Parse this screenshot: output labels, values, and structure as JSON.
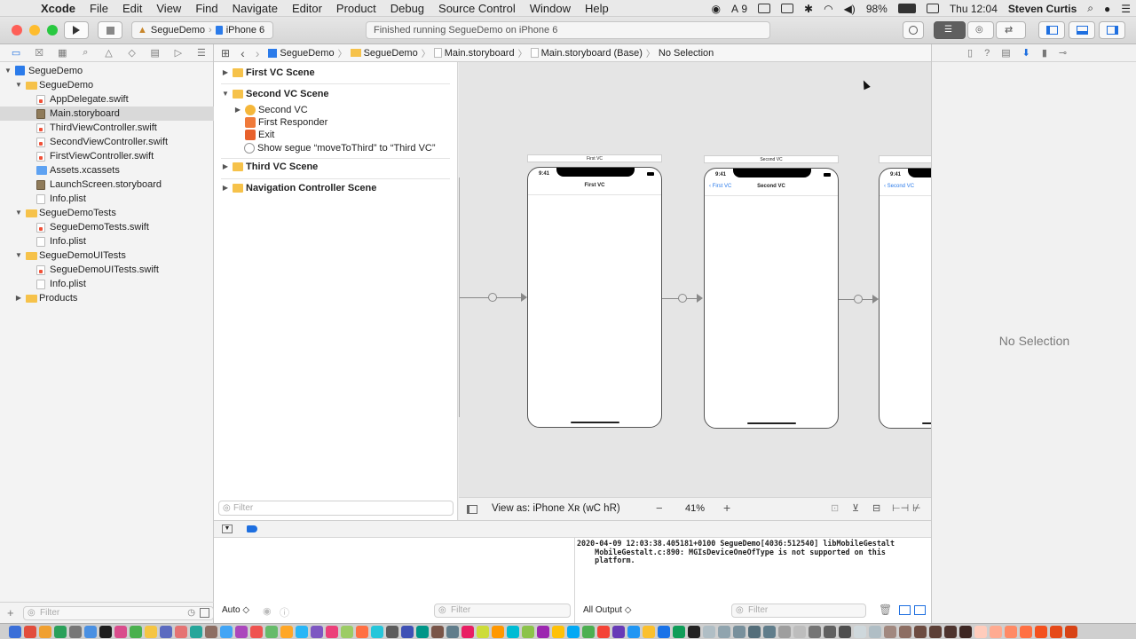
{
  "menubar": {
    "app": "Xcode",
    "menus": [
      "File",
      "Edit",
      "View",
      "Find",
      "Navigate",
      "Editor",
      "Product",
      "Debug",
      "Source Control",
      "Window",
      "Help"
    ],
    "adobe_count": "9",
    "battery": "98%",
    "clock": "Thu 12:04",
    "user": "Steven Curtis"
  },
  "toolbar": {
    "scheme": "SegueDemo",
    "device": "iPhone 6",
    "status": "Finished running SegueDemo on iPhone 6"
  },
  "navigator": {
    "tree": [
      {
        "label": "SegueDemo",
        "icon": "project-icon",
        "level": 0,
        "expanded": true
      },
      {
        "label": "SegueDemo",
        "icon": "folder-icon",
        "level": 1,
        "expanded": true
      },
      {
        "label": "AppDelegate.swift",
        "icon": "swift-file-icon",
        "level": 2
      },
      {
        "label": "Main.storyboard",
        "icon": "storyboard-icon",
        "level": 2,
        "selected": true
      },
      {
        "label": "ThirdViewController.swift",
        "icon": "swift-file-icon",
        "level": 2
      },
      {
        "label": "SecondViewController.swift",
        "icon": "swift-file-icon",
        "level": 2
      },
      {
        "label": "FirstViewController.swift",
        "icon": "swift-file-icon",
        "level": 2
      },
      {
        "label": "Assets.xcassets",
        "icon": "assets-icon",
        "level": 2
      },
      {
        "label": "LaunchScreen.storyboard",
        "icon": "storyboard-icon",
        "level": 2
      },
      {
        "label": "Info.plist",
        "icon": "plist-icon",
        "level": 2
      },
      {
        "label": "SegueDemoTests",
        "icon": "folder-icon",
        "level": 1,
        "expanded": true
      },
      {
        "label": "SegueDemoTests.swift",
        "icon": "swift-file-icon",
        "level": 2
      },
      {
        "label": "Info.plist",
        "icon": "plist-icon",
        "level": 2
      },
      {
        "label": "SegueDemoUITests",
        "icon": "folder-icon",
        "level": 1,
        "expanded": true
      },
      {
        "label": "SegueDemoUITests.swift",
        "icon": "swift-file-icon",
        "level": 2
      },
      {
        "label": "Info.plist",
        "icon": "plist-icon",
        "level": 2
      },
      {
        "label": "Products",
        "icon": "folder-icon",
        "level": 1,
        "expanded": false
      }
    ],
    "filter_placeholder": "Filter"
  },
  "jumpbar": {
    "crumbs": [
      "SegueDemo",
      "SegueDemo",
      "Main.storyboard",
      "Main.storyboard (Base)",
      "No Selection"
    ]
  },
  "outline": {
    "scene1": "First VC Scene",
    "scene2": "Second VC Scene",
    "scene2_items": [
      "Second VC",
      "First Responder",
      "Exit",
      "Show segue “moveToThird” to “Third VC”"
    ],
    "scene3": "Third VC Scene",
    "scene4": "Navigation Controller Scene",
    "filter_placeholder": "Filter"
  },
  "canvas": {
    "phones": [
      {
        "title": "First VC",
        "nav_title": "First VC",
        "back": "",
        "time": "9:41"
      },
      {
        "title": "Second VC",
        "nav_title": "Second VC",
        "back": "First VC",
        "time": "9:41"
      },
      {
        "title": "",
        "nav_title": "",
        "back": "Second VC",
        "time": "9:41"
      }
    ],
    "view_as": "View as: iPhone Xʀ (wC hR)",
    "zoom": "41%"
  },
  "debug": {
    "auto_label": "Auto ◇",
    "filter_placeholder": "Filter",
    "output_label": "All Output ◇",
    "console": "2020-04-09 12:03:38.405181+0100 SegueDemo[4036:512540] libMobileGestalt\n    MobileGestalt.c:890: MGIsDeviceOneOfType is not supported on this\n    platform."
  },
  "inspector": {
    "empty_text": "No Selection"
  },
  "colors": {
    "accent": "#1e6fe0",
    "folder": "#f6c24a",
    "close": "#fe5f57",
    "minimize": "#febc2e",
    "zoom": "#28c840"
  }
}
